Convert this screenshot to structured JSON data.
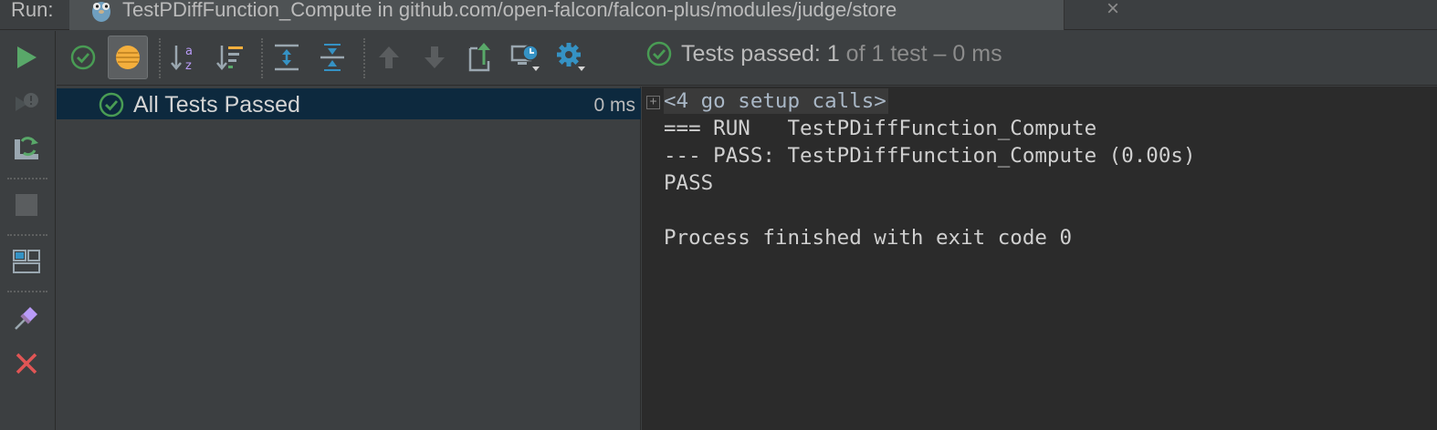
{
  "title_bar": {
    "run_label": "Run:",
    "tab_title": "TestPDiffFunction_Compute in github.com/open-falcon/falcon-plus/modules/judge/store",
    "tab_close": "×",
    "tab_icon": "gopher-icon"
  },
  "side_toolbar": {
    "items": [
      "rerun-icon",
      "rerun-failed-icon",
      "toggle-auto-test-icon",
      "stop-icon",
      "restore-layout-icon",
      "pin-tab-icon",
      "close-icon"
    ]
  },
  "toolbar": {
    "items": [
      "show-passed-icon",
      "show-ignored-icon",
      "sort-alphabetically-icon",
      "sort-by-duration-icon",
      "expand-all-icon",
      "collapse-all-icon",
      "previous-failed-icon",
      "next-failed-icon",
      "export-results-icon",
      "test-history-icon",
      "settings-icon"
    ],
    "status_prefix": "Tests passed:",
    "status_count": "1",
    "status_suffix": "of 1 test – 0 ms"
  },
  "test_tree": {
    "rows": [
      {
        "label": "All Tests Passed",
        "time": "0 ms",
        "status": "passed"
      }
    ]
  },
  "console": {
    "expander": "+",
    "fold_text": "<4 go setup calls>",
    "lines": [
      "=== RUN   TestPDiffFunction_Compute",
      "--- PASS: TestPDiffFunction_Compute (0.00s)",
      "PASS",
      "",
      "Process finished with exit code 0"
    ]
  },
  "colors": {
    "passed": "#499c54",
    "run_green": "#59a869",
    "stop_red": "#e05555",
    "selection": "#0d293e",
    "console_bg": "#2b2b2b"
  }
}
